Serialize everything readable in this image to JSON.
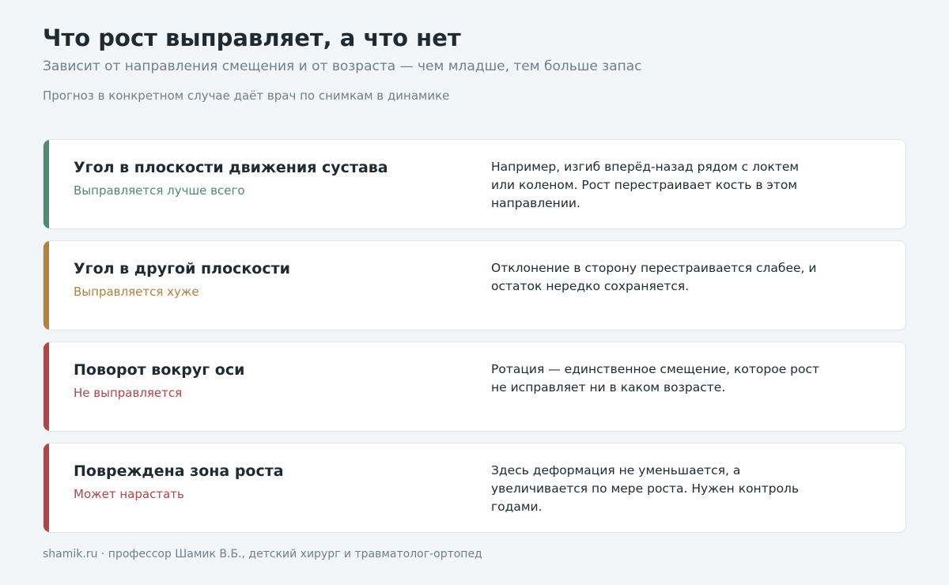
{
  "header": {
    "title": "Что рост выправляет, а что нет",
    "subtitle": "Зависит от направления смещения и от возраста — чем младше, тем больше запас",
    "note": "Прогноз в конкретном случае даёт врач по снимкам в динамике"
  },
  "cards": [
    {
      "title": "Угол в плоскости движения сустава",
      "status": "Выправляется лучше всего",
      "description": "Например, изгиб вперёд-назад рядом с локтем или коленом. Рост перестраивает кость в этом направлении.",
      "accent_color": "#4f8a6f"
    },
    {
      "title": "Угол в другой плоскости",
      "status": "Выправляется хуже",
      "description": "Отклонение в сторону перестраивается слабее, и остаток нередко сохраняется.",
      "accent_color": "#b3813a"
    },
    {
      "title": "Поворот вокруг оси",
      "status": "Не выправляется",
      "description": "Ротация — единственное смещение, которое рост не исправляет ни в каком возрасте.",
      "accent_color": "#b24545"
    },
    {
      "title": "Повреждена зона роста",
      "status": "Может нарастать",
      "description": "Здесь деформация не уменьшается, а увеличивается по мере роста. Нужен контроль годами.",
      "accent_color": "#b24545"
    }
  ],
  "footer": {
    "text": "shamik.ru · профессор Шамик В.Б., детский хирург и травматолог-ортопед"
  }
}
